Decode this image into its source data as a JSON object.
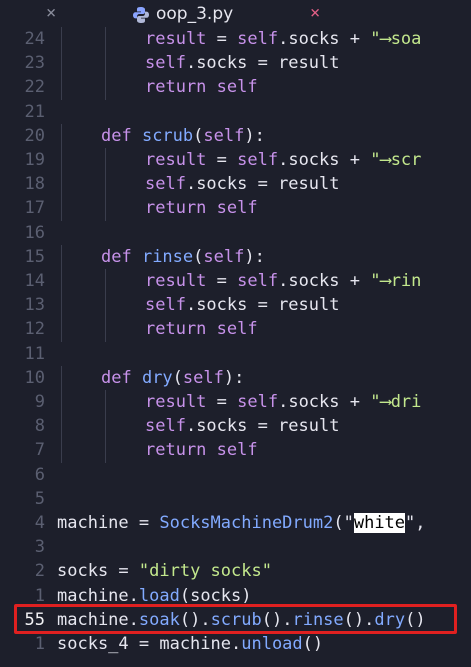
{
  "tab": {
    "inactive_close": "×",
    "title": "oop_3.py",
    "active_close": "×"
  },
  "lines": [
    {
      "num": "24",
      "parts": [
        [
          "self",
          "result"
        ],
        [
          "op",
          " = "
        ],
        [
          "self",
          "self"
        ],
        [
          "op",
          ".socks + "
        ],
        [
          "str",
          "\"⟶soa"
        ]
      ],
      "indent": 2
    },
    {
      "num": "23",
      "parts": [
        [
          "self",
          "self"
        ],
        [
          "op",
          ".socks = result"
        ]
      ],
      "indent": 2
    },
    {
      "num": "22",
      "parts": [
        [
          "kw",
          "return "
        ],
        [
          "self",
          "self"
        ]
      ],
      "indent": 2
    },
    {
      "num": "21",
      "parts": [],
      "indent": 0
    },
    {
      "num": "20",
      "parts": [
        [
          "kw",
          "def "
        ],
        [
          "fn",
          "scrub"
        ],
        [
          "op",
          "("
        ],
        [
          "self",
          "self"
        ],
        [
          "op",
          "):"
        ]
      ],
      "indent": 1
    },
    {
      "num": "19",
      "parts": [
        [
          "self",
          "result"
        ],
        [
          "op",
          " = "
        ],
        [
          "self",
          "self"
        ],
        [
          "op",
          ".socks + "
        ],
        [
          "str",
          "\"⟶scr"
        ]
      ],
      "indent": 2
    },
    {
      "num": "18",
      "parts": [
        [
          "self",
          "self"
        ],
        [
          "op",
          ".socks = result"
        ]
      ],
      "indent": 2
    },
    {
      "num": "17",
      "parts": [
        [
          "kw",
          "return "
        ],
        [
          "self",
          "self"
        ]
      ],
      "indent": 2
    },
    {
      "num": "16",
      "parts": [],
      "indent": 0
    },
    {
      "num": "15",
      "parts": [
        [
          "kw",
          "def "
        ],
        [
          "fn",
          "rinse"
        ],
        [
          "op",
          "("
        ],
        [
          "self",
          "self"
        ],
        [
          "op",
          "):"
        ]
      ],
      "indent": 1
    },
    {
      "num": "14",
      "parts": [
        [
          "self",
          "result"
        ],
        [
          "op",
          " = "
        ],
        [
          "self",
          "self"
        ],
        [
          "op",
          ".socks + "
        ],
        [
          "str",
          "\"⟶rin"
        ]
      ],
      "indent": 2
    },
    {
      "num": "13",
      "parts": [
        [
          "self",
          "self"
        ],
        [
          "op",
          ".socks = result"
        ]
      ],
      "indent": 2
    },
    {
      "num": "12",
      "parts": [
        [
          "kw",
          "return "
        ],
        [
          "self",
          "self"
        ]
      ],
      "indent": 2
    },
    {
      "num": "11",
      "parts": [],
      "indent": 0
    },
    {
      "num": "10",
      "parts": [
        [
          "kw",
          "def "
        ],
        [
          "fn",
          "dry"
        ],
        [
          "op",
          "("
        ],
        [
          "self",
          "self"
        ],
        [
          "op",
          "):"
        ]
      ],
      "indent": 1
    },
    {
      "num": "9",
      "parts": [
        [
          "self",
          "result"
        ],
        [
          "op",
          " = "
        ],
        [
          "self",
          "self"
        ],
        [
          "op",
          ".socks + "
        ],
        [
          "str",
          "\"⟶dri"
        ]
      ],
      "indent": 2
    },
    {
      "num": "8",
      "parts": [
        [
          "self",
          "self"
        ],
        [
          "op",
          ".socks = result"
        ]
      ],
      "indent": 2
    },
    {
      "num": "7",
      "parts": [
        [
          "kw",
          "return "
        ],
        [
          "self",
          "self"
        ]
      ],
      "indent": 2
    },
    {
      "num": "6",
      "parts": [],
      "indent": 0
    },
    {
      "num": "5",
      "parts": [],
      "indent": 0
    },
    {
      "num": "4",
      "parts": [
        [
          "op",
          "machine = "
        ],
        [
          "cls",
          "SocksMachineDrum2"
        ],
        [
          "op",
          "(\""
        ],
        [
          "sel",
          "white"
        ],
        [
          "op",
          "\","
        ]
      ],
      "indent": 0
    },
    {
      "num": "3",
      "parts": [],
      "indent": 0
    },
    {
      "num": "2",
      "parts": [
        [
          "op",
          "socks = "
        ],
        [
          "str",
          "\"dirty socks\""
        ]
      ],
      "indent": 0
    },
    {
      "num": "1",
      "parts": [
        [
          "op",
          "machine."
        ],
        [
          "fn",
          "load"
        ],
        [
          "op",
          "(socks)"
        ]
      ],
      "indent": 0
    },
    {
      "num": "55",
      "current": true,
      "parts": [
        [
          "op",
          "machine."
        ],
        [
          "fn",
          "soak"
        ],
        [
          "op",
          "()."
        ],
        [
          "fn",
          "scrub"
        ],
        [
          "op",
          "()."
        ],
        [
          "fn",
          "rinse"
        ],
        [
          "op",
          "()."
        ],
        [
          "fn",
          "dry"
        ],
        [
          "op",
          "()"
        ]
      ],
      "indent": 0
    },
    {
      "num": "1",
      "parts": [
        [
          "op",
          "socks_4 = machine."
        ],
        [
          "fn",
          "unload"
        ],
        [
          "op",
          "()"
        ]
      ],
      "indent": 0
    }
  ],
  "colors": {
    "background": "#1d1f2b",
    "highlight_border": "#e02020"
  }
}
